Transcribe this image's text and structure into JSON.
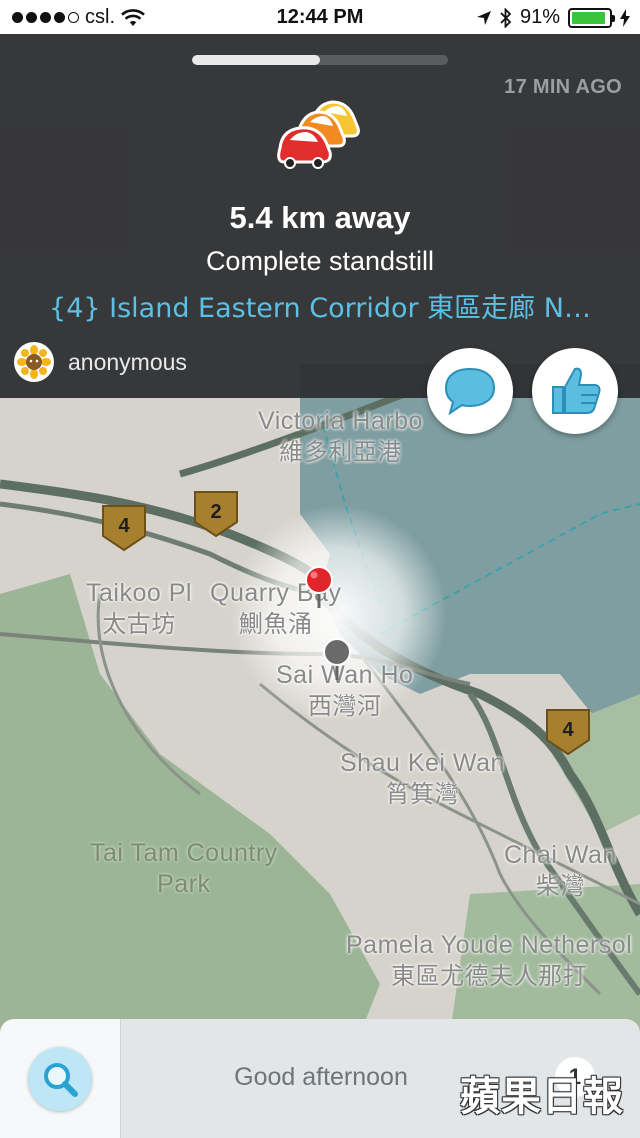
{
  "status_bar": {
    "carrier": "csl.",
    "time": "12:44 PM",
    "battery_percent": "91%",
    "battery_level": 0.91,
    "battery_color": "#3bc43b",
    "icons": [
      "signal-dots-icon",
      "wifi-icon",
      "location-arrow-icon",
      "bluetooth-icon",
      "battery-icon",
      "charging-bolt-icon"
    ]
  },
  "alert": {
    "time_ago": "17 MIN AGO",
    "progress": 0.5,
    "icon": "traffic-jam-icon",
    "distance": "5.4 km away",
    "status": "Complete standstill",
    "street": "{4} Island Eastern Corridor 東區走廊 N…",
    "reporter": "anonymous",
    "reporter_icon": "sunflower-avatar-icon",
    "street_color": "#5cc0e4"
  },
  "actions": {
    "comment_icon": "speech-bubble-icon",
    "thanks_icon": "thumbs-up-icon",
    "accent_color": "#5bbde0"
  },
  "map": {
    "labels": [
      {
        "en": "Victoria Harbo",
        "zh": "維多利亞港"
      },
      {
        "en": "Taikoo Pl",
        "zh": "太古坊"
      },
      {
        "en": "Quarry Bay",
        "zh": "鰂魚涌"
      },
      {
        "en": "Sai Wan Ho",
        "zh": "西灣河"
      },
      {
        "en": "Shau Kei Wan",
        "zh": "筲箕灣"
      },
      {
        "en": "Chai Wan",
        "zh": "柴灣"
      },
      {
        "en": "Pamela Youde Nethersol",
        "zh": "東區尤德夫人那打"
      }
    ],
    "park": {
      "line1": "Tai Tam Country",
      "line2": "Park"
    },
    "route_shields": [
      "4",
      "2",
      "4"
    ],
    "colors": {
      "land": "#d6d3cc",
      "water": "#7f9ea1",
      "park": "#9cb596",
      "road": "#5d6f63",
      "report_pin": "#e0262b"
    }
  },
  "bottom": {
    "search_icon": "search-icon",
    "greeting": "Good afternoon",
    "badge": "1"
  },
  "watermark": "蘋果日報"
}
